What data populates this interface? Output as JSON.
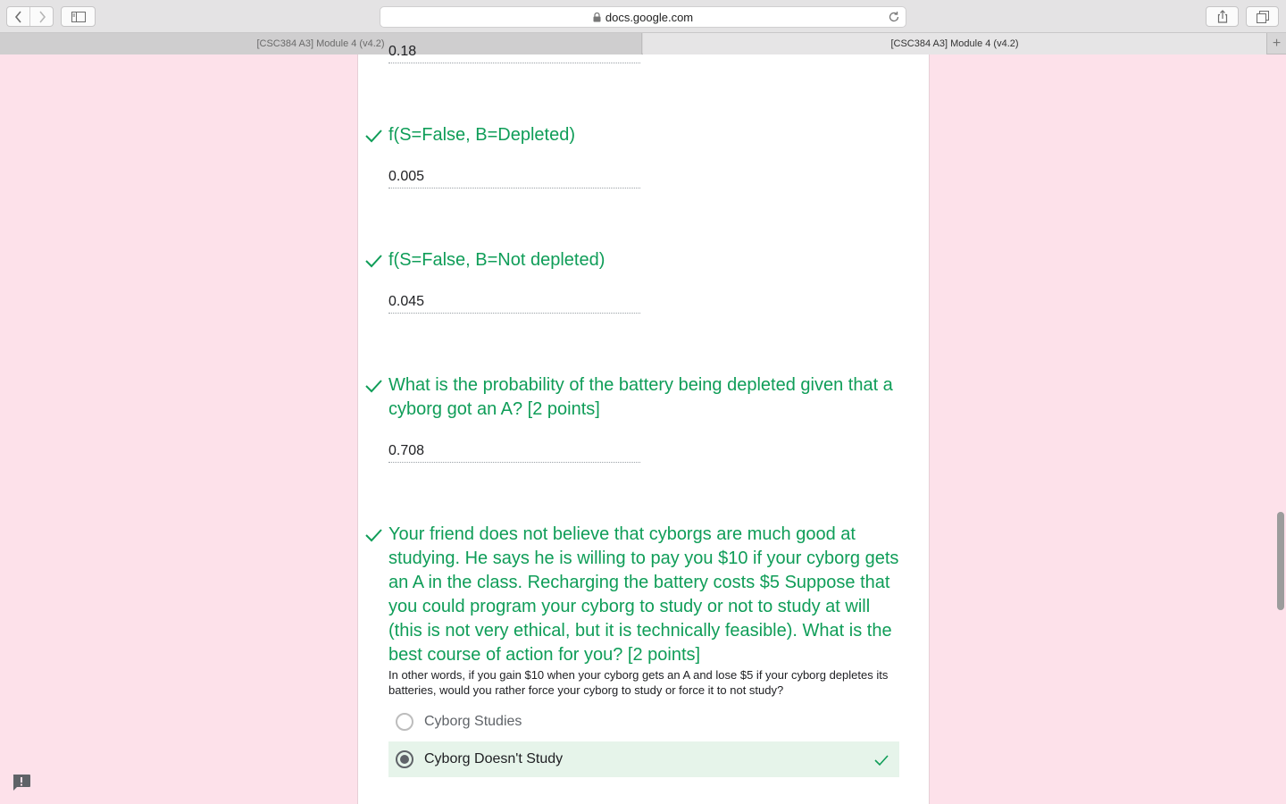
{
  "browser": {
    "url": "docs.google.com",
    "tabs": [
      {
        "label": "[CSC384 A3] Module 4 (v4.2)",
        "active": false
      },
      {
        "label": "[CSC384 A3] Module 4 (v4.2)",
        "active": true
      }
    ],
    "new_tab_symbol": "+"
  },
  "form": {
    "cut_off_answer": "0.18",
    "questions": [
      {
        "title": "f(S=False, B=Depleted)",
        "answer": "0.005",
        "correct": true
      },
      {
        "title": "f(S=False, B=Not depleted)",
        "answer": "0.045",
        "correct": true
      },
      {
        "title": "What is the probability of the battery being depleted given that a cyborg got an A? [2 points]",
        "answer": "0.708",
        "correct": true
      },
      {
        "title": "Your friend does not believe that cyborgs are much good at studying. He says he is willing to pay you $10 if your cyborg gets an A in the class. Recharging the battery costs $5 Suppose that you could program your cyborg to study or not to study at will (this is not very ethical, but it is technically feasible). What is the best course of action for you? [2 points]",
        "description": "In other words, if you gain $10 when your cyborg gets an A and lose $5 if your cyborg depletes its batteries, would you rather force your cyborg to study or force it to not study?",
        "options": [
          {
            "label": "Cyborg Studies",
            "selected": false
          },
          {
            "label": "Cyborg Doesn't Study",
            "selected": true
          }
        ],
        "correct": true
      }
    ]
  },
  "colors": {
    "page_bg": "#fde1ea",
    "correct_green": "#0f9d58",
    "selected_bg": "#e6f4ea"
  }
}
